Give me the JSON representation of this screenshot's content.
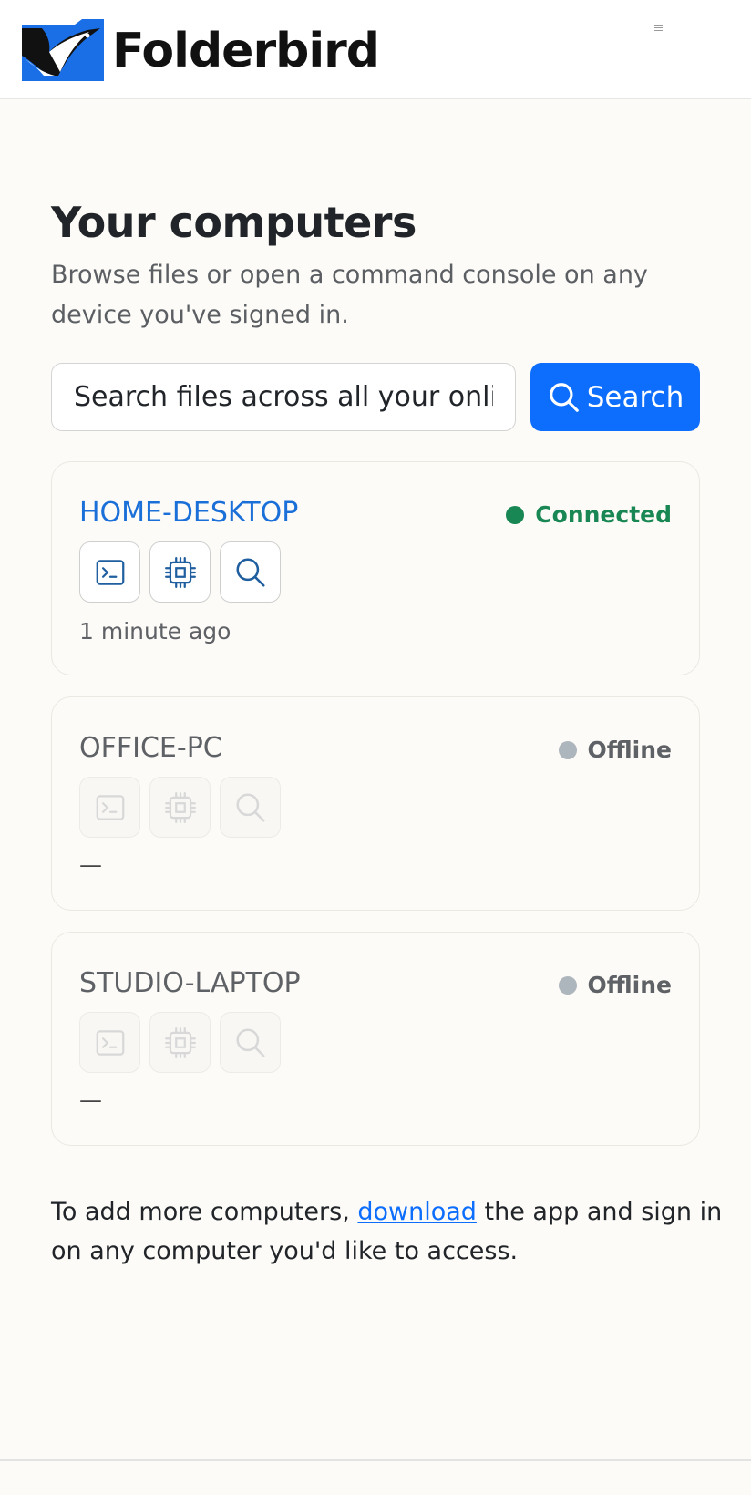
{
  "header": {
    "brand": "Folderbird",
    "menu_icon": "hamburger-menu-icon"
  },
  "main": {
    "title": "Your computers",
    "subtitle": "Browse files or open a command console on any device you've signed in.",
    "search": {
      "placeholder": "Search files across all your online computers",
      "button_label": "Search",
      "button_icon": "search-icon"
    }
  },
  "computers": [
    {
      "name": "HOME-DESKTOP",
      "status": "Connected",
      "online": true,
      "last_seen": "1 minute ago",
      "actions": [
        "terminal-icon",
        "cpu-chip-icon",
        "search-icon"
      ]
    },
    {
      "name": "OFFICE-PC",
      "status": "Offline",
      "online": false,
      "last_seen": "—",
      "actions": [
        "terminal-icon",
        "cpu-chip-icon",
        "search-icon"
      ]
    },
    {
      "name": "STUDIO-LAPTOP",
      "status": "Offline",
      "online": false,
      "last_seen": "—",
      "actions": [
        "terminal-icon",
        "cpu-chip-icon",
        "search-icon"
      ]
    }
  ],
  "footer": {
    "text_before": "To add more computers, ",
    "link_label": "download",
    "text_after": " the app and sign in on any computer you'd like to access."
  },
  "colors": {
    "accent": "#0d6efd",
    "connected": "#198754",
    "offline_dot": "#adb5bd",
    "page_background": "#fdfbf7"
  }
}
